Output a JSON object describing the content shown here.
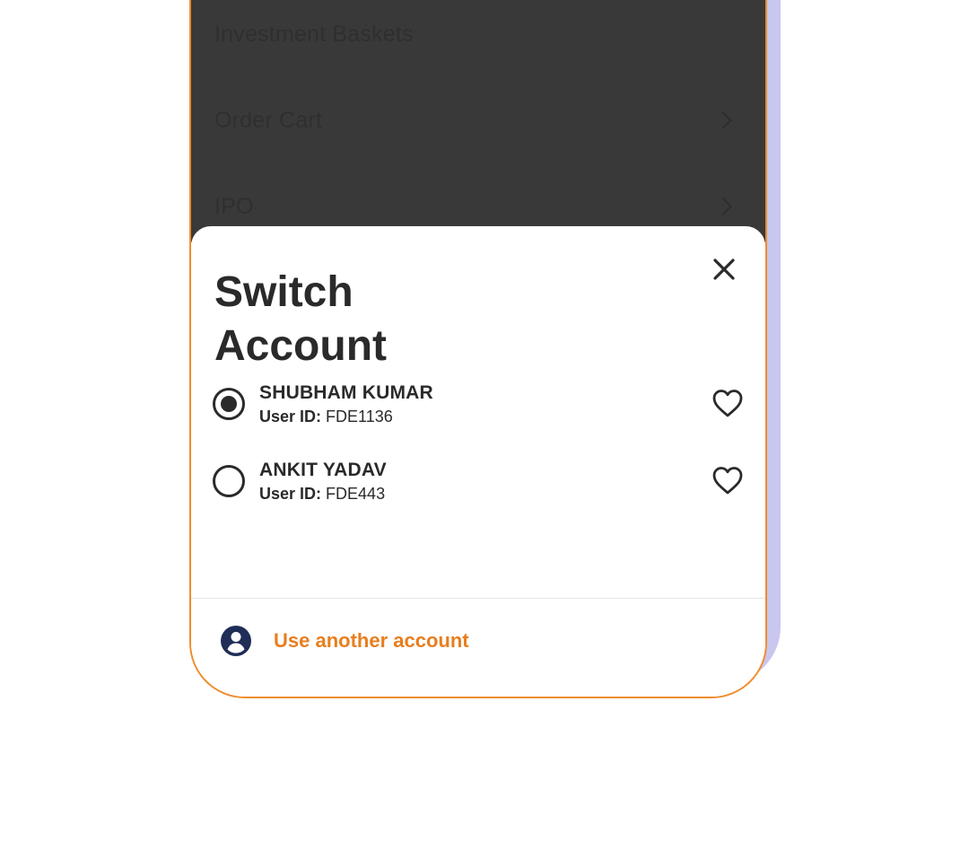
{
  "menu": {
    "items": [
      {
        "label": "Investment Baskets",
        "has_chevron": false
      },
      {
        "label": "Order Cart",
        "has_chevron": true
      },
      {
        "label": "IPO",
        "has_chevron": true
      }
    ]
  },
  "sheet": {
    "title": "Switch Account",
    "close_icon": "close-icon",
    "accounts": [
      {
        "name": "SHUBHAM KUMAR",
        "user_id_label": "User ID:",
        "user_id": "FDE1136",
        "selected": true,
        "favorite_icon": "heart-outline-icon"
      },
      {
        "name": "ANKIT YADAV",
        "user_id_label": "User ID:",
        "user_id": "FDE443",
        "selected": false,
        "favorite_icon": "heart-outline-icon"
      }
    ],
    "use_another": {
      "label": "Use another account",
      "icon": "account-circle-icon"
    }
  },
  "colors": {
    "accent": "#e87e1e",
    "frame_border": "#f08c2c",
    "user_icon": "#1f2d57",
    "overlay": "#393939",
    "text": "#2a2a2a",
    "backplate": "#c9c6ef"
  }
}
